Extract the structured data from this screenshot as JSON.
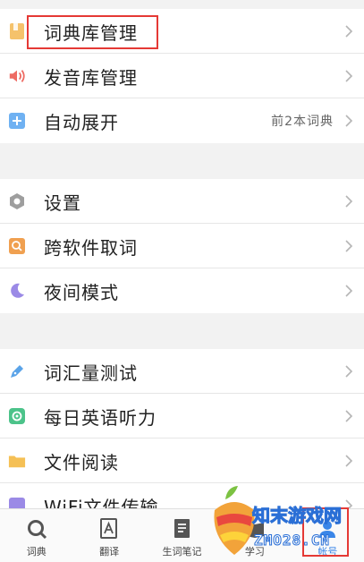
{
  "settings_group_1": [
    {
      "label": "词典库管理",
      "value": "",
      "icon": "book-icon"
    },
    {
      "label": "发音库管理",
      "value": "",
      "icon": "speaker-icon"
    },
    {
      "label": "自动展开",
      "value": "前2本词典",
      "icon": "plus-icon"
    }
  ],
  "settings_group_2": [
    {
      "label": "设置",
      "value": "",
      "icon": "hexagon-settings-icon"
    },
    {
      "label": "跨软件取词",
      "value": "",
      "icon": "search-icon"
    },
    {
      "label": "夜间模式",
      "value": "",
      "icon": "moon-icon"
    }
  ],
  "settings_group_3": [
    {
      "label": "词汇量测试",
      "value": "",
      "icon": "pen-icon"
    },
    {
      "label": "每日英语听力",
      "value": "",
      "icon": "headphone-icon"
    },
    {
      "label": "文件阅读",
      "value": "",
      "icon": "folder-icon"
    },
    {
      "label": "WiFi文件传输",
      "value": "",
      "icon": "wifi-icon"
    }
  ],
  "tabbar": [
    {
      "label": "词典",
      "icon": "dictionary-search-icon",
      "active": false
    },
    {
      "label": "翻译",
      "icon": "translate-icon",
      "active": false
    },
    {
      "label": "生词笔记",
      "icon": "notebook-icon",
      "active": false
    },
    {
      "label": "学习",
      "icon": "learn-icon",
      "active": false
    },
    {
      "label": "帐号",
      "icon": "account-icon",
      "active": true
    }
  ],
  "watermark": {
    "line1": "知末游戏网",
    "line2": "ZMO28.CN"
  },
  "colors": {
    "accent": "#3a86e8",
    "highlight": "#e53935",
    "background": "#f2f2f2"
  }
}
